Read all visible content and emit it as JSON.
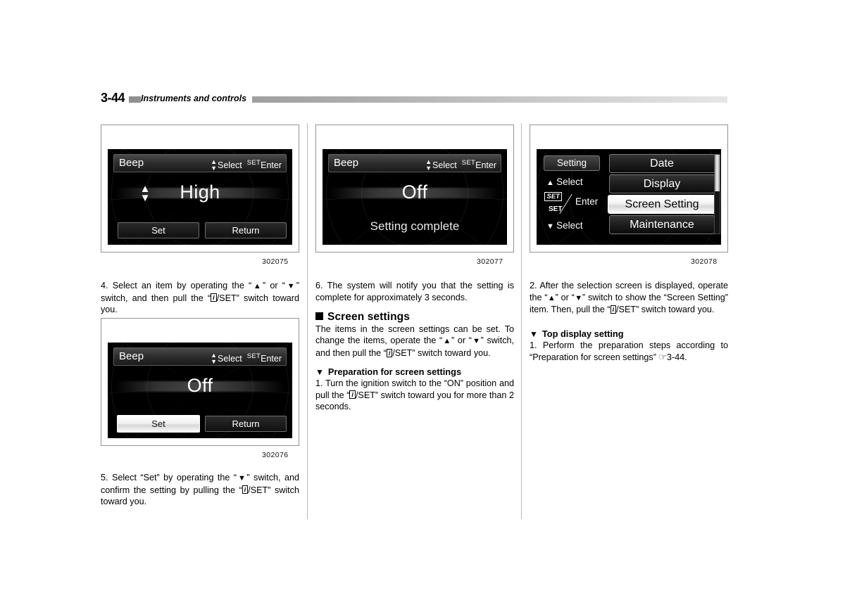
{
  "header": {
    "page_number": "3-44",
    "section_title": "Instruments and controls"
  },
  "figures": [
    {
      "id": "302075",
      "screen": {
        "title": "Beep",
        "select_label": "Select",
        "enter_sup": "SET",
        "enter_label": "Enter",
        "value": "High",
        "buttons": [
          {
            "label": "Set",
            "highlighted": false
          },
          {
            "label": "Return",
            "highlighted": false
          }
        ]
      }
    },
    {
      "id": "302077",
      "screen": {
        "title": "Beep",
        "select_label": "Select",
        "enter_sup": "SET",
        "enter_label": "Enter",
        "value": "Off",
        "status": "Setting complete"
      }
    },
    {
      "id": "302078",
      "screen": {
        "side_label": "Setting",
        "select_up": "Select",
        "enter_label": "Enter",
        "enter_sub": "SET",
        "select_down": "Select",
        "menu": [
          {
            "label": "Date",
            "highlighted": false
          },
          {
            "label": "Display",
            "highlighted": false
          },
          {
            "label": "Screen Setting",
            "highlighted": true
          },
          {
            "label": "Maintenance",
            "highlighted": false
          }
        ]
      }
    },
    {
      "id": "302076",
      "screen": {
        "title": "Beep",
        "select_label": "Select",
        "enter_sup": "SET",
        "enter_label": "Enter",
        "value": "Off",
        "buttons": [
          {
            "label": "Set",
            "highlighted": true
          },
          {
            "label": "Return",
            "highlighted": false
          }
        ]
      }
    }
  ],
  "column_left": {
    "step4": {
      "a": "4.  Select an item by operating the “",
      "up": "▲",
      "b": "” or “",
      "down": "▼",
      "c": "” switch, and then pull the “",
      "i": "i",
      "d": "/SET” switch toward you."
    },
    "step5": {
      "a": "5. Select “Set” by operating the “",
      "down": "▼",
      "b": "” switch, and confirm the setting by pulling the “",
      "i": "i",
      "c": "/SET” switch toward you."
    }
  },
  "column_mid": {
    "step6": "6.  The system will notify you that the setting is complete for approximately 3 seconds.",
    "heading": "Screen settings",
    "intro": {
      "a": "The items in the screen settings can be set. To change the items, operate the “",
      "up": "▲",
      "b": "” or “",
      "down": "▼",
      "c": "” switch, and then pull the “",
      "i": "i",
      "d": "/SET” switch toward you."
    },
    "subheading": "Preparation for screen settings",
    "step1": {
      "a": "1.  Turn the ignition switch to the “ON” position and pull the “",
      "i": "i",
      "b": "/SET” switch toward you for more than 2 seconds."
    }
  },
  "column_right": {
    "step2": {
      "a": "2.  After the selection screen is displayed, operate the “",
      "up": "▲",
      "b": "” or “",
      "down": "▼",
      "c": "” switch to show the “Screen Setting” item. Then, pull the “",
      "i": "i",
      "d": "/SET” switch toward you."
    },
    "subheading": "Top display setting",
    "step1": {
      "a": "1.  Perform the preparation steps according to “Preparation for screen settings” ",
      "hand": "☞",
      "b": "3-44."
    }
  },
  "glyphs": {
    "triangle_down": "▼",
    "square": "■"
  }
}
